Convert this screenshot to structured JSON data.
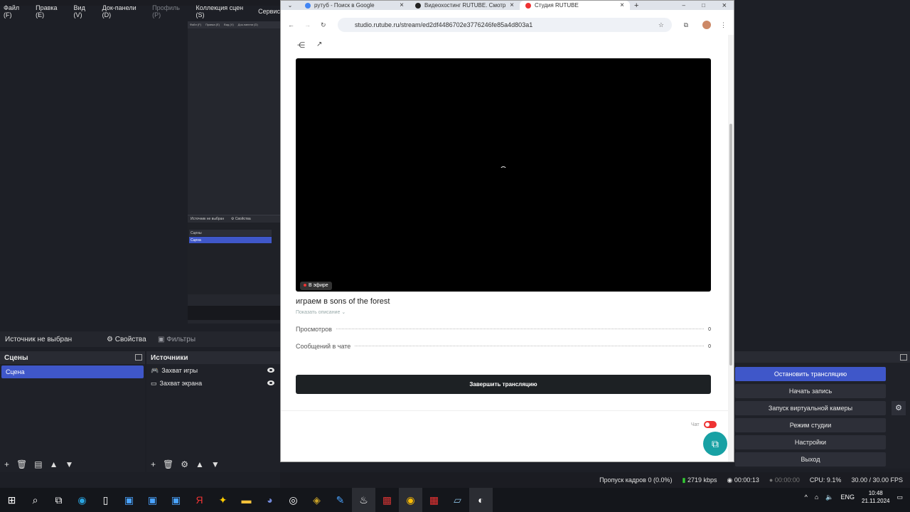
{
  "obs": {
    "menu": [
      "Файл (F)",
      "Правка (E)",
      "Вид (V)",
      "Док-панели (D)",
      "Профиль (P)",
      "Коллекция сцен (S)",
      "Сервис"
    ],
    "source_status": "Источник не выбран",
    "properties_label": "Свойства",
    "filters_label": "Фильтры",
    "scenes_title": "Сцены",
    "scenes": [
      "Сцена"
    ],
    "sources_title": "Источники",
    "sources": [
      "Захват игры",
      "Захват экрана"
    ],
    "controls": [
      "Остановить трансляцию",
      "Начать запись",
      "Запуск виртуальной камеры",
      "Режим студии",
      "Настройки",
      "Выход"
    ],
    "status": {
      "dropped": "Пропуск кадров 0 (0.0%)",
      "bitrate": "2719 kbps",
      "live_time": "00:00:13",
      "rec_time": "00:00:00",
      "cpu": "CPU: 9.1%",
      "fps": "30.00 / 30.00 FPS"
    },
    "mini": {
      "menu": [
        "Файл (F)",
        "Правка (E)",
        "Вид (V)",
        "Док-панели (D)"
      ],
      "source_status": "Источник не выбран",
      "properties": "Свойства",
      "scenes": "Сцены",
      "scene": "Сцена"
    }
  },
  "browser": {
    "tabs": [
      {
        "title": "рутуб - Поиск в Google",
        "color": "#4285f4"
      },
      {
        "title": "Видеохостинг RUTUBE. Смотр",
        "color": "#222"
      },
      {
        "title": "Студия RUTUBE",
        "color": "#e33"
      }
    ],
    "url": "studio.rutube.ru/stream/ed2df4486702e3776246fe85a4d803a1"
  },
  "stream": {
    "live_badge": "В эфире",
    "title": "играем в sons of the forest",
    "show_description": "Показать описание",
    "views_label": "Просмотров",
    "views": "0",
    "chat_label": "Сообщений в чате",
    "chat_count": "0",
    "end_button": "Завершить трансляцию",
    "chat_toggle_label": "Чат",
    "chat_toggle_on": true
  },
  "taskbar": {
    "lang": "ENG",
    "time": "10:48",
    "date": "21.11.2024"
  }
}
